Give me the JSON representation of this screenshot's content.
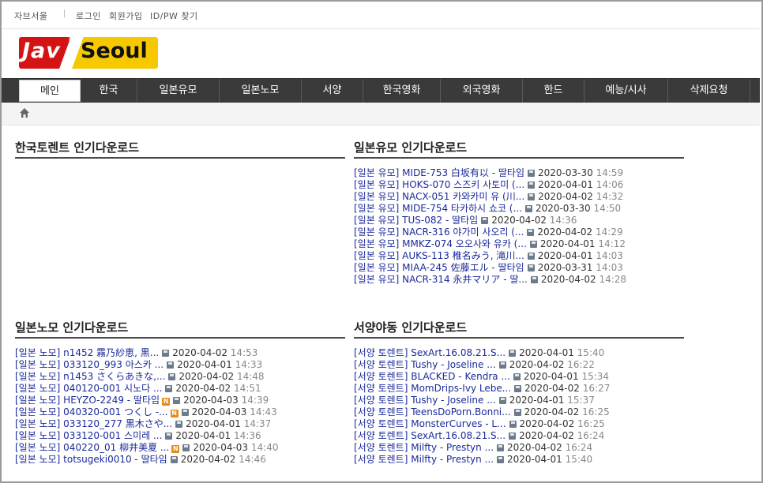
{
  "topbar": {
    "links": [
      "자브서울",
      "로그인",
      "회원가입",
      "ID/PW 찾기"
    ],
    "separator": "|"
  },
  "logo": {
    "part1": "Jav",
    "part2": "Seoul"
  },
  "nav": {
    "items": [
      "메인",
      "한국",
      "일본유모",
      "일본노모",
      "서양",
      "한국영화",
      "외국영화",
      "한드",
      "예능/시사",
      "삭제요청"
    ]
  },
  "sections": [
    {
      "title": "한국토렌트 인기다운로드",
      "rows": []
    },
    {
      "title": "일본유모 인기다운로드",
      "rows": [
        {
          "cat": "[일본 유모]",
          "title": "MIDE-753 白坂有以 - 딸타임",
          "date": "2020-03-30",
          "time": "14:59"
        },
        {
          "cat": "[일본 유모]",
          "title": "HOKS-070 스즈키 사토미 (...",
          "date": "2020-04-01",
          "time": "14:06"
        },
        {
          "cat": "[일본 유모]",
          "title": "NACX-051 카와카미 유 (川...",
          "date": "2020-04-02",
          "time": "14:32"
        },
        {
          "cat": "[일본 유모]",
          "title": "MIDE-754 타카하시 쇼코 (...",
          "date": "2020-03-30",
          "time": "14:50"
        },
        {
          "cat": "[일본 유모]",
          "title": "TUS-082 - 딸타임",
          "date": "2020-04-02",
          "time": "14:36"
        },
        {
          "cat": "[일본 유모]",
          "title": "NACR-316 야가미 사오리 (...",
          "date": "2020-04-02",
          "time": "14:29"
        },
        {
          "cat": "[일본 유모]",
          "title": "MMKZ-074 오오사와 유카 (...",
          "date": "2020-04-01",
          "time": "14:12"
        },
        {
          "cat": "[일본 유모]",
          "title": "AUKS-113 椎名みう, 滝川...",
          "date": "2020-04-01",
          "time": "14:03"
        },
        {
          "cat": "[일본 유모]",
          "title": "MIAA-245 佐藤エル - 딸타임",
          "date": "2020-03-31",
          "time": "14:03"
        },
        {
          "cat": "[일본 유모]",
          "title": "NACR-314 永井マリア - 딸...",
          "date": "2020-04-02",
          "time": "14:28"
        }
      ]
    },
    {
      "title": "일본노모 인기다운로드",
      "rows": [
        {
          "cat": "[일본 노모]",
          "title": "n1452 霧乃紗恵, 黒...",
          "date": "2020-04-02",
          "time": "14:53",
          "new": false
        },
        {
          "cat": "[일본 노모]",
          "title": "033120_993 아스카 ...",
          "date": "2020-04-01",
          "time": "14:33",
          "new": false
        },
        {
          "cat": "[일본 노모]",
          "title": "n1453 さくらあきな,...",
          "date": "2020-04-02",
          "time": "14:48",
          "new": false
        },
        {
          "cat": "[일본 노모]",
          "title": "040120-001 시노다 ...",
          "date": "2020-04-02",
          "time": "14:51",
          "new": false
        },
        {
          "cat": "[일본 노모]",
          "title": "HEYZO-2249 - 딸타임",
          "date": "2020-04-03",
          "time": "14:39",
          "new": true
        },
        {
          "cat": "[일본 노모]",
          "title": "040320-001 つくし -...",
          "date": "2020-04-03",
          "time": "14:43",
          "new": true
        },
        {
          "cat": "[일본 노모]",
          "title": "033120_277 黒木さや...",
          "date": "2020-04-01",
          "time": "14:37",
          "new": false
        },
        {
          "cat": "[일본 노모]",
          "title": "033120-001 스미레 ...",
          "date": "2020-04-01",
          "time": "14:36",
          "new": false
        },
        {
          "cat": "[일본 노모]",
          "title": "040220_01 柳井美夏 ...",
          "date": "2020-04-03",
          "time": "14:40",
          "new": true
        },
        {
          "cat": "[일본 노모]",
          "title": "totsugeki0010 - 딸타임",
          "date": "2020-04-02",
          "time": "14:46",
          "new": false
        }
      ]
    },
    {
      "title": "서양야동 인기다운로드",
      "rows": [
        {
          "cat": "[서양 토렌트]",
          "title": "SexArt.16.08.21.S...",
          "date": "2020-04-01",
          "time": "15:40"
        },
        {
          "cat": "[서양 토렌트]",
          "title": "Tushy - Joseline ...",
          "date": "2020-04-02",
          "time": "16:22"
        },
        {
          "cat": "[서양 토렌트]",
          "title": "BLACKED - Kendra ...",
          "date": "2020-04-01",
          "time": "15:34"
        },
        {
          "cat": "[서양 토렌트]",
          "title": "MomDrips-Ivy Lebe...",
          "date": "2020-04-02",
          "time": "16:27"
        },
        {
          "cat": "[서양 토렌트]",
          "title": "Tushy - Joseline ...",
          "date": "2020-04-01",
          "time": "15:37"
        },
        {
          "cat": "[서양 토렌트]",
          "title": "TeensDoPorn.Bonni...",
          "date": "2020-04-02",
          "time": "16:25"
        },
        {
          "cat": "[서양 토렌트]",
          "title": "MonsterCurves - L...",
          "date": "2020-04-02",
          "time": "16:25"
        },
        {
          "cat": "[서양 토렌트]",
          "title": "SexArt.16.08.21.S...",
          "date": "2020-04-02",
          "time": "16:24"
        },
        {
          "cat": "[서양 토렌트]",
          "title": "Milfty - Prestyn ...",
          "date": "2020-04-02",
          "time": "16:24"
        },
        {
          "cat": "[서양 토렌트]",
          "title": "Milfty - Prestyn ...",
          "date": "2020-04-01",
          "time": "15:40"
        }
      ]
    }
  ],
  "icons": {
    "home": "home-icon",
    "file": "file-icon",
    "new": "new-badge-icon",
    "new_label": "N"
  }
}
